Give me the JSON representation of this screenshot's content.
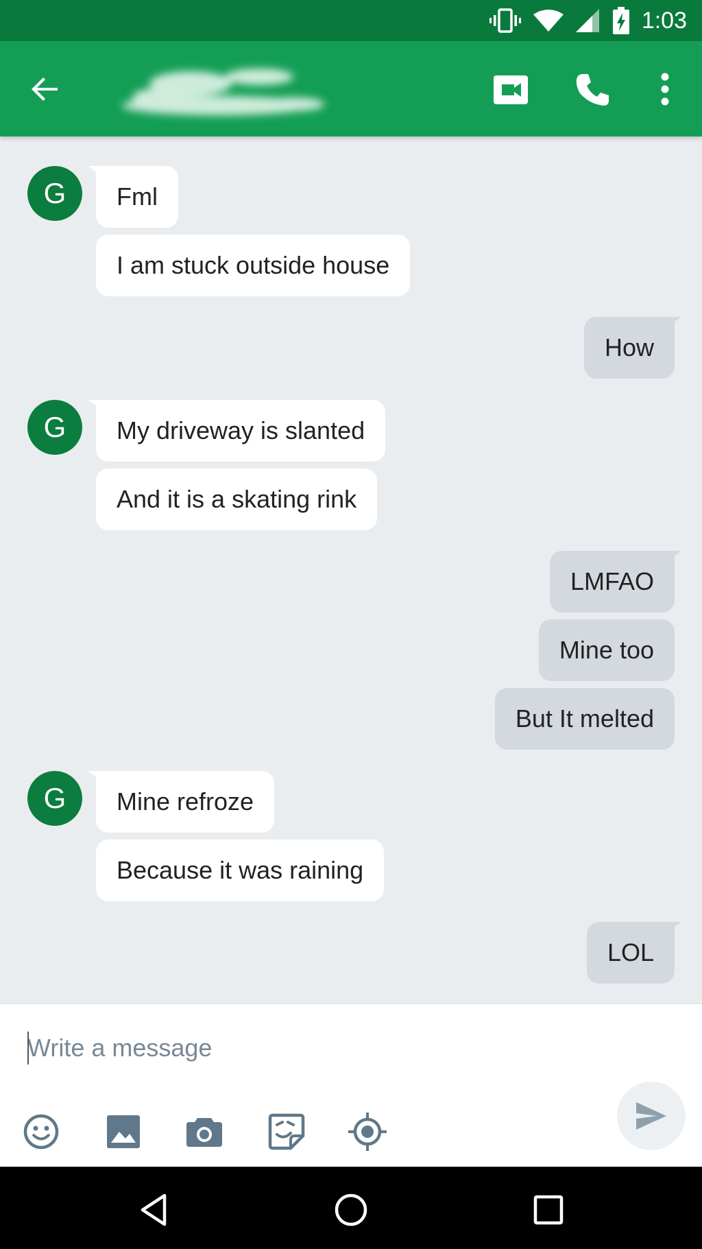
{
  "status_bar": {
    "time": "1:03",
    "icons": [
      "vibrate-icon",
      "wifi-icon",
      "signal-icon",
      "battery-charging-icon"
    ]
  },
  "app_bar": {
    "icons": [
      "back-arrow-icon",
      "video-call-icon",
      "phone-icon",
      "more-vert-icon"
    ],
    "contact_name_redacted": true
  },
  "messages": [
    {
      "direction": "in",
      "avatar": "G",
      "text": "Fml"
    },
    {
      "direction": "in",
      "text": "I am stuck outside house"
    },
    {
      "direction": "out",
      "text": "How"
    },
    {
      "direction": "in",
      "avatar": "G",
      "text": "My driveway is slanted"
    },
    {
      "direction": "in",
      "text": "And it is a skating rink"
    },
    {
      "direction": "out",
      "text": "LMFAO"
    },
    {
      "direction": "out",
      "text": "Mine too"
    },
    {
      "direction": "out",
      "text": "But It melted"
    },
    {
      "direction": "in",
      "avatar": "G",
      "text": "Mine refroze"
    },
    {
      "direction": "in",
      "text": "Because it was raining"
    },
    {
      "direction": "out",
      "text": "LOL"
    }
  ],
  "compose": {
    "placeholder": "Write a message",
    "value": "",
    "tools": [
      "emoji-icon",
      "image-icon",
      "camera-icon",
      "sticker-icon",
      "location-icon"
    ],
    "send_icon": "send-icon"
  },
  "nav_bar": {
    "buttons": [
      "back-triangle-icon",
      "home-circle-icon",
      "recents-square-icon"
    ]
  },
  "colors": {
    "status_bar": "#0a7a3c",
    "app_bar": "#149e55",
    "avatar": "#0b7d3e",
    "background": "#eaedf0",
    "incoming_bubble": "#ffffff",
    "outgoing_bubble": "#d3d9de"
  }
}
